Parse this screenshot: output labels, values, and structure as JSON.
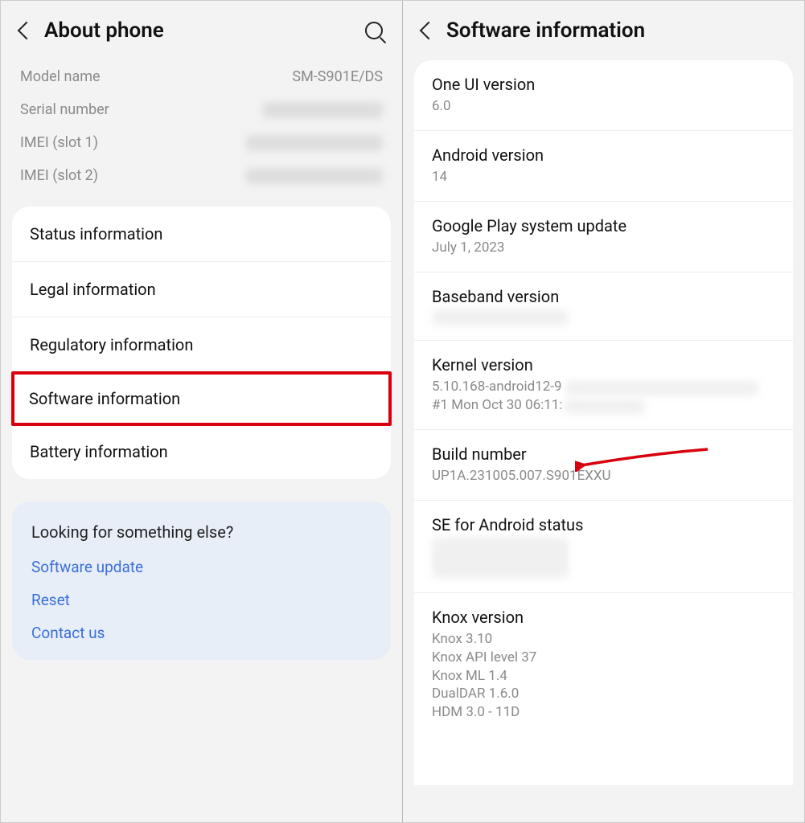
{
  "left": {
    "title": "About phone",
    "info": {
      "model_label": "Model name",
      "model_value": "SM-S901E/DS",
      "serial_label": "Serial number",
      "imei1_label": "IMEI (slot 1)",
      "imei2_label": "IMEI (slot 2)"
    },
    "items": [
      "Status information",
      "Legal information",
      "Regulatory information",
      "Software information",
      "Battery information"
    ],
    "footer": {
      "title": "Looking for something else?",
      "links": [
        "Software update",
        "Reset",
        "Contact us"
      ]
    }
  },
  "right": {
    "title": "Software information",
    "items": {
      "oneui_label": "One UI version",
      "oneui_value": "6.0",
      "android_label": "Android version",
      "android_value": "14",
      "play_label": "Google Play system update",
      "play_value": "July 1, 2023",
      "baseband_label": "Baseband version",
      "kernel_label": "Kernel version",
      "kernel_value1": "5.10.168-android12-9",
      "kernel_value2": "#1 Mon Oct 30 06:11:",
      "build_label": "Build number",
      "build_value": "UP1A.231005.007.S901EXXU",
      "se_label": "SE for Android status",
      "knox_label": "Knox version",
      "knox_lines": [
        "Knox 3.10",
        "Knox API level 37",
        "Knox ML 1.4",
        "DualDAR 1.6.0",
        "HDM 3.0 - 11D"
      ]
    }
  }
}
